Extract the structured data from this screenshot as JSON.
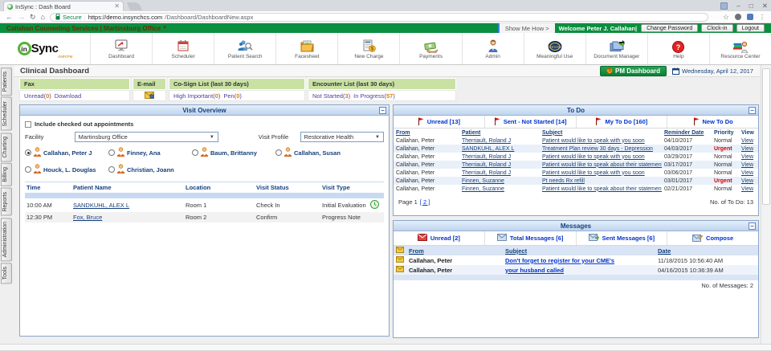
{
  "colors": {
    "brand_green": "#0a8f3e",
    "panel_navy": "#16407c",
    "urgent_red": "#cc0000",
    "count_orange": "#e07b00",
    "summary_link_purple": "#4a3f9e",
    "tab_link_blue": "#0033cc",
    "summary_header_green": "#c9e2a4"
  },
  "browser": {
    "tab_title": "InSync : Dash Board",
    "secure_label": "Secure",
    "url_domain": "https://demo.insynchcs.com",
    "url_path": "/Dashboard/DashboardNew.aspx"
  },
  "org_bar": {
    "title": "Callahan Counseling Services   |   Martinsburg Office",
    "show_me_how": "Show Me How >",
    "welcome": "Welcome Peter J. Callahan|",
    "buttons": [
      {
        "label": "Change Password",
        "name": "change-password-button"
      },
      {
        "label": "Clock-in",
        "name": "clock-in-button"
      },
      {
        "label": "Logout",
        "name": "logout-button"
      }
    ]
  },
  "logo": {
    "in": "in",
    "sync": "Sync",
    "sub": "EMR/PM"
  },
  "nav": {
    "items": [
      {
        "label": "Dashboard",
        "icon": "dashboard-icon"
      },
      {
        "label": "Scheduler",
        "icon": "scheduler-icon"
      },
      {
        "label": "Patient Search",
        "icon": "patient-search-icon"
      },
      {
        "label": "Facesheet",
        "icon": "facesheet-icon"
      },
      {
        "label": "New Charge",
        "icon": "new-charge-icon"
      },
      {
        "label": "Payments",
        "icon": "payments-icon"
      },
      {
        "label": "Admin",
        "icon": "admin-icon"
      },
      {
        "label": "Meaningful Use",
        "icon": "meaningful-use-icon"
      },
      {
        "label": "Document Manager",
        "icon": "document-manager-icon"
      },
      {
        "label": "Help",
        "icon": "help-icon"
      },
      {
        "label": "Resource Center",
        "icon": "resource-center-icon"
      }
    ]
  },
  "sidebar": {
    "tabs": [
      "Patients",
      "Scheduler",
      "Charting",
      "Billing",
      "Reports",
      "Administration",
      "Tools"
    ]
  },
  "page": {
    "title": "Clinical Dashboard",
    "pm_dashboard_label": "PM Dashboard",
    "date": "Wednesday, April 12, 2017"
  },
  "summary": {
    "cells": [
      {
        "header": "Fax",
        "links": [
          {
            "label": "Unread",
            "count": "0"
          },
          {
            "label": "Download"
          }
        ]
      },
      {
        "header": "E-mail",
        "icon": "email-icon"
      },
      {
        "header": "Co-Sign List (last 30 days)",
        "links": [
          {
            "label": "High Important",
            "count": "0"
          },
          {
            "label": "Pen",
            "count": "0"
          }
        ]
      },
      {
        "header": "Encounter List (last 30 days)",
        "links": [
          {
            "label": "Not Started",
            "count": "3"
          },
          {
            "label": "In Progress",
            "count": "57"
          }
        ]
      }
    ]
  },
  "visit_overview": {
    "title": "Visit Overview",
    "include_label": "Include checked out appointments",
    "facility_label": "Facility",
    "facility_value": "Martinsburg Office",
    "visit_profile_label": "Visit Profile",
    "visit_profile_value": "Restorative Health",
    "providers": [
      {
        "name": "Callahan, Peter J",
        "selected": true
      },
      {
        "name": "Finney, Ana",
        "selected": false
      },
      {
        "name": "Baum, Brittanny",
        "selected": false
      },
      {
        "name": "Callahan, Susan",
        "selected": false
      },
      {
        "name": "Houck, L. Douglas",
        "selected": false
      },
      {
        "name": "Christian, Joann",
        "selected": false
      }
    ],
    "table_headers": [
      "Time",
      "Patient Name",
      "Location",
      "Visit Status",
      "Visit Type"
    ],
    "rows": [
      {
        "time": "10:00 AM",
        "patient": "SANDKUHL, ALEX L",
        "location": "Room 1",
        "status": "Check In",
        "type": "Initial Evaluation",
        "has_icon": true
      },
      {
        "time": "12:30 PM",
        "patient": "Fox, Bruce",
        "location": "Room 2",
        "status": "Confirm",
        "type": "Progress Note",
        "has_icon": false
      }
    ]
  },
  "todo": {
    "title": "To Do",
    "tabs": [
      {
        "label": "Unread [13]",
        "icon": "flag-icon"
      },
      {
        "label": "Sent - Not Started [14]",
        "icon": "flag-icon"
      },
      {
        "label": "My To Do [160]",
        "icon": "flag-icon"
      },
      {
        "label": "New To Do",
        "icon": "flag-icon"
      }
    ],
    "headers": [
      {
        "label": "From",
        "sortable": true
      },
      {
        "label": "Patient",
        "sortable": true
      },
      {
        "label": "Subject",
        "sortable": true
      },
      {
        "label": "Reminder Date",
        "sortable": true
      },
      {
        "label": "Priority",
        "sortable": false
      },
      {
        "label": "View",
        "sortable": false
      }
    ],
    "rows": [
      {
        "from": "Callahan, Peter",
        "patient": "Therriault, Roland J",
        "subject": "Patient would like to speak with you soon",
        "date": "04/10/2017",
        "priority": "Normal",
        "view": "View"
      },
      {
        "from": "Callahan, Peter",
        "patient": "SANDKUHL, ALEX L",
        "subject": "Treatment Plan review 30 days - Depression",
        "date": "04/03/2017",
        "priority": "Urgent",
        "view": "View"
      },
      {
        "from": "Callahan, Peter",
        "patient": "Therriault, Roland J",
        "subject": "Patient would like to speak with you soon",
        "date": "03/29/2017",
        "priority": "Normal",
        "view": "View"
      },
      {
        "from": "Callahan, Peter",
        "patient": "Therriault, Roland J",
        "subject": "Patient would like to speak about their statement",
        "date": "03/17/2017",
        "priority": "Normal",
        "view": "View"
      },
      {
        "from": "Callahan, Peter",
        "patient": "Therriault, Roland J",
        "subject": "Patient would like to speak with you soon",
        "date": "03/06/2017",
        "priority": "Normal",
        "view": "View"
      },
      {
        "from": "Callahan, Peter",
        "patient": "Finnen, Suzanne",
        "subject": "Pt needs Rx refill",
        "date": "03/01/2017",
        "priority": "Urgent",
        "view": "View"
      },
      {
        "from": "Callahan, Peter",
        "patient": "Finnen, Suzanne",
        "subject": "Patient would like to speak about their statement",
        "date": "02/21/2017",
        "priority": "Normal",
        "view": "View"
      }
    ],
    "footer": {
      "page_label": "Page 1",
      "page_link": "[ 2 ]",
      "count_label": "No. of To Do: 13"
    }
  },
  "messages": {
    "title": "Messages",
    "tabs": [
      {
        "label": "Unread [2]",
        "icon": "envelope-unread-icon"
      },
      {
        "label": "Total Messages [6]",
        "icon": "envelope-total-icon"
      },
      {
        "label": "Sent Messages [6]",
        "icon": "envelope-sent-icon"
      },
      {
        "label": "Compose",
        "icon": "envelope-compose-icon"
      }
    ],
    "headers": [
      "From",
      "Subject",
      "Date"
    ],
    "rows": [
      {
        "from": "Callahan, Peter",
        "subject": "Don't forget to register for your CME's",
        "date": "11/18/2015 10:56:40 AM"
      },
      {
        "from": "Callahan, Peter",
        "subject": "your husband called",
        "date": "04/16/2015 10:36:39 AM"
      }
    ],
    "footer_count": "No. of Messages: 2"
  }
}
